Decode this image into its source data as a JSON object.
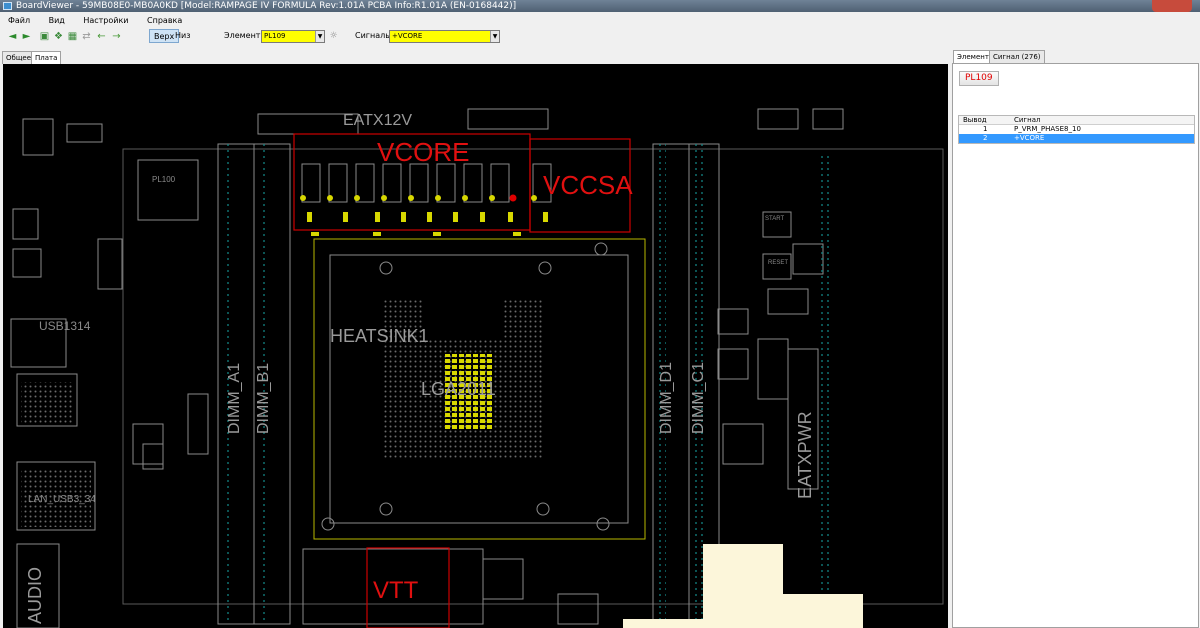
{
  "window": {
    "title": "BoardViewer  -  59MB08E0-MB0A0KD [Model:RAMPAGE IV FORMULA Rev:1.01A PCBA Info:R1.01A (EN-0168442)]"
  },
  "menu": [
    "Файл",
    "Вид",
    "Настройки",
    "Справка"
  ],
  "toolbar": {
    "side_top": "Верх",
    "side_bottom": "Низ",
    "elements_label": "Элементы:",
    "elements_value": "PL109",
    "signals_label": "Сигналы:",
    "signals_value": "+VCORE",
    "icons": [
      "back-icon",
      "forward-icon",
      "zoom-fit-icon",
      "layers-icon",
      "grid-icon",
      "flip-icon",
      "arrow-left-icon",
      "arrow-right-icon"
    ]
  },
  "left_tabs": [
    "Общее",
    "Плата"
  ],
  "board": {
    "labels": {
      "eatx12v": "EATX12V",
      "vcore": "VCORE",
      "vccsa": "VCCSA",
      "heatsink": "HEATSINK1",
      "lga": "LGA2011",
      "vtt": "VTT",
      "dimm_a1": "DIMM_A1",
      "dimm_b1": "DIMM_B1",
      "dimm_d1": "DIMM_D1",
      "dimm_c1": "DIMM_C1",
      "eatxpwr": "EATXPWR",
      "usb": "USB1314",
      "lan": "LAN_USB3_34",
      "audio": "AUDIO",
      "pl100": "PL100",
      "start": "START",
      "reset": "RESET"
    },
    "colors": {
      "background": "#000000",
      "outline": "#8a8a8a",
      "highlight": "#cc0000",
      "label_red": "#e01010",
      "pad": "#d8d800",
      "socket": "#b7b700"
    }
  },
  "right_tabs": [
    "Элемент",
    "Сигнал (276)"
  ],
  "panel": {
    "element_name": "PL109",
    "table": {
      "columns": [
        "Вывод",
        "Сигнал"
      ],
      "rows": [
        {
          "pin": "1",
          "signal": "P_VRM_PHASE8_10"
        },
        {
          "pin": "2",
          "signal": "+VCORE"
        }
      ]
    }
  }
}
